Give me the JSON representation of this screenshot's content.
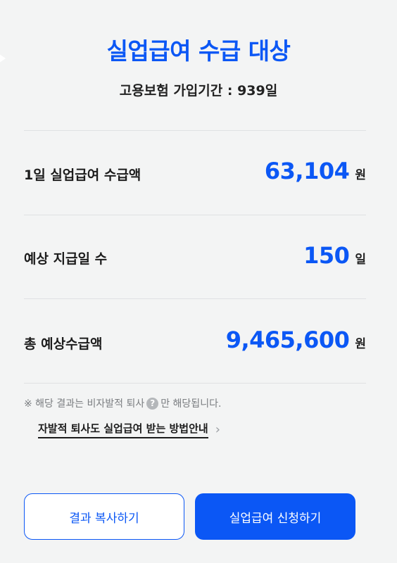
{
  "header": {
    "title": "실업급여 수급 대상",
    "subtitle": "고용보험 가입기간 : 939일"
  },
  "results": [
    {
      "label": "1일 실업급여 수급액",
      "value": "63,104",
      "unit": "원"
    },
    {
      "label": "예상 지급일 수",
      "value": "150",
      "unit": "일"
    },
    {
      "label": "총 예상수급액",
      "value": "9,465,600",
      "unit": "원"
    }
  ],
  "note": {
    "text_before": "※ 해당 결과는 비자발적 퇴사",
    "help_icon": "?",
    "text_after": "만 해당됩니다."
  },
  "guide_link": {
    "label": "자발적 퇴사도 실업급여 받는 방법안내",
    "icon": "chevron-right-icon"
  },
  "buttons": {
    "copy_label": "결과 복사하기",
    "apply_label": "실업급여 신청하기"
  },
  "colors": {
    "accent": "#0b57f5",
    "background": "#f3f4f4"
  }
}
